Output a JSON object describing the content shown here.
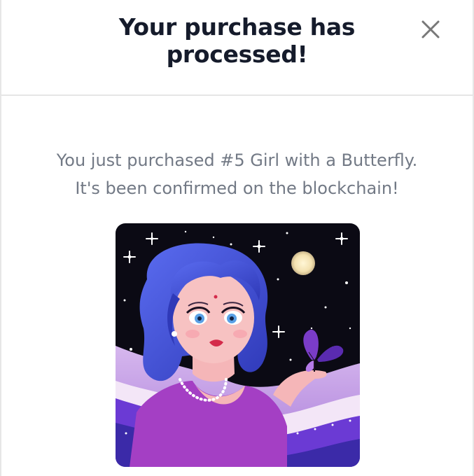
{
  "modal": {
    "title": "Your purchase has processed!",
    "close_icon": "close-icon",
    "message_line1": "You just purchased #5 Girl with a Butterfly.",
    "message_line2": "It's been confirmed on the blockchain!"
  },
  "colors": {
    "title": "#151b2b",
    "message": "#727985",
    "close_icon": "#787878",
    "divider": "#e6e6e6",
    "art_background": "#0b0a14",
    "art_hair": "#3f52d8",
    "art_dress": "#a43fc4"
  }
}
